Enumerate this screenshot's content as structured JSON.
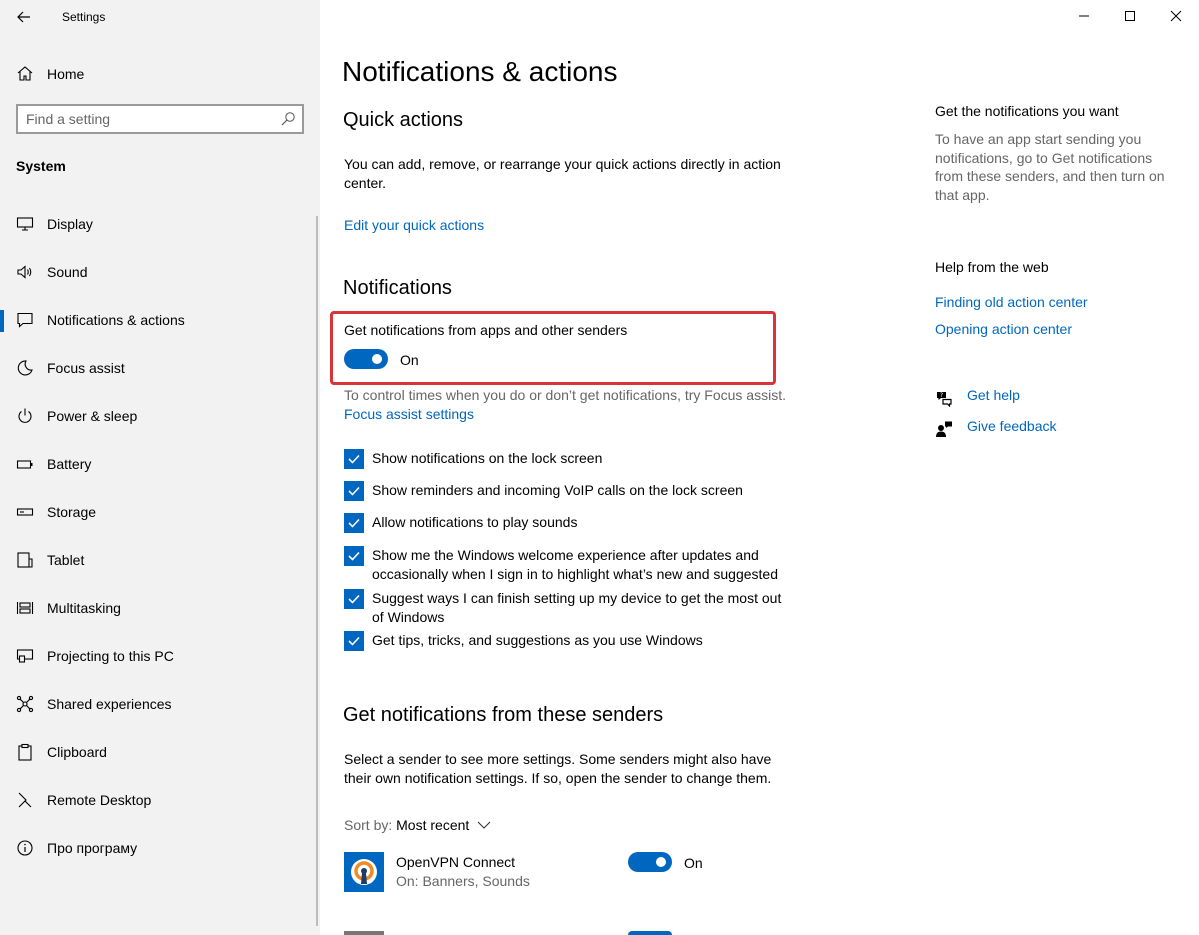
{
  "window": {
    "app_title": "Settings",
    "controls": [
      "minimize-icon",
      "maximize-icon",
      "close-icon"
    ]
  },
  "sidebar": {
    "home_label": "Home",
    "search_placeholder": "Find a setting",
    "section_label": "System",
    "items": [
      {
        "label": "Display",
        "icon": "display-icon",
        "active": false
      },
      {
        "label": "Sound",
        "icon": "speaker-icon",
        "active": false
      },
      {
        "label": "Notifications & actions",
        "icon": "notification-icon",
        "active": true
      },
      {
        "label": "Focus assist",
        "icon": "moon-icon",
        "active": false
      },
      {
        "label": "Power & sleep",
        "icon": "power-icon",
        "active": false
      },
      {
        "label": "Battery",
        "icon": "battery-icon",
        "active": false
      },
      {
        "label": "Storage",
        "icon": "storage-icon",
        "active": false
      },
      {
        "label": "Tablet",
        "icon": "tablet-icon",
        "active": false
      },
      {
        "label": "Multitasking",
        "icon": "multitasking-icon",
        "active": false
      },
      {
        "label": "Projecting to this PC",
        "icon": "projecting-icon",
        "active": false
      },
      {
        "label": "Shared experiences",
        "icon": "shared-icon",
        "active": false
      },
      {
        "label": "Clipboard",
        "icon": "clipboard-icon",
        "active": false
      },
      {
        "label": "Remote Desktop",
        "icon": "remote-desktop-icon",
        "active": false
      },
      {
        "label": "Про програму",
        "icon": "info-icon",
        "active": false
      }
    ]
  },
  "main": {
    "page_title": "Notifications & actions",
    "quick_actions": {
      "heading": "Quick actions",
      "description": "You can add, remove, or rearrange your quick actions directly in action center.",
      "link": "Edit your quick actions"
    },
    "notifications": {
      "heading": "Notifications",
      "master_toggle_label": "Get notifications from apps and other senders",
      "master_toggle_state": "On",
      "focus_text": "To control times when you do or don’t get notifications, try Focus assist.",
      "focus_link": "Focus assist settings",
      "checkboxes": [
        {
          "label": "Show notifications on the lock screen",
          "checked": true
        },
        {
          "label": "Show reminders and incoming VoIP calls on the lock screen",
          "checked": true
        },
        {
          "label": "Allow notifications to play sounds",
          "checked": true
        },
        {
          "label": "Show me the Windows welcome experience after updates and occasionally when I sign in to highlight what’s new and suggested",
          "checked": true
        },
        {
          "label": "Suggest ways I can finish setting up my device to get the most out of Windows",
          "checked": true
        },
        {
          "label": "Get tips, tricks, and suggestions as you use Windows",
          "checked": true
        }
      ]
    },
    "senders": {
      "heading": "Get notifications from these senders",
      "description": "Select a sender to see more settings. Some senders might also have their own notification settings. If so, open the sender to change them.",
      "sort_label": "Sort by:",
      "sort_value": "Most recent",
      "apps": [
        {
          "name": "OpenVPN Connect",
          "subtitle": "On: Banners, Sounds",
          "state": "On"
        }
      ]
    }
  },
  "right": {
    "get_heading": "Get the notifications you want",
    "get_text": "To have an app start sending you notifications, go to Get notifications from these senders, and then turn on that app.",
    "web_heading": "Help from the web",
    "web_links": [
      "Finding old action center",
      "Opening action center"
    ],
    "get_help": "Get help",
    "give_feedback": "Give feedback"
  },
  "colors": {
    "accent": "#0067c0",
    "highlight": "#d9343a",
    "sidebar_bg": "#f2f2f2"
  }
}
